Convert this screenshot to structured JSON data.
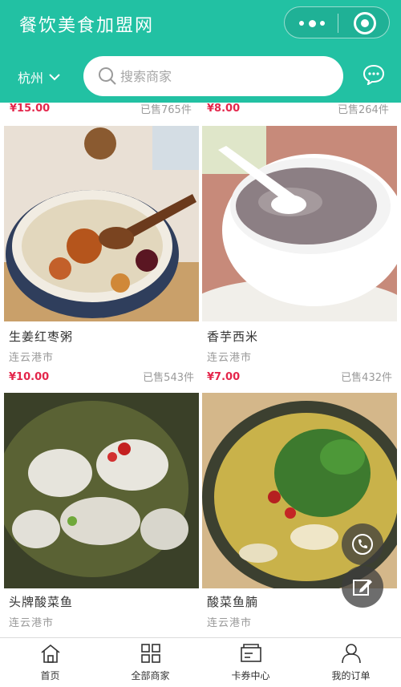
{
  "header": {
    "title": "餐饮美食加盟网",
    "menu_icon": "more-dots-icon",
    "close_icon": "target-icon"
  },
  "search": {
    "city": "杭州",
    "placeholder": "搜索商家",
    "message_icon": "chat-bubble-icon"
  },
  "top_partial_row": [
    {
      "price": "¥15.00",
      "sold": "已售765件"
    },
    {
      "price": "¥8.00",
      "sold": "已售264件"
    }
  ],
  "products": [
    {
      "name": "生姜红枣粥",
      "location": "连云港市",
      "price": "¥10.00",
      "sold": "已售543件",
      "image": "porridge-bowl"
    },
    {
      "name": "香芋西米",
      "location": "连云港市",
      "price": "¥7.00",
      "sold": "已售432件",
      "image": "taro-sago-bowl"
    },
    {
      "name": "头牌酸菜鱼",
      "location": "连云港市",
      "image": "pickled-fish"
    },
    {
      "name": "酸菜鱼腩",
      "location": "连云港市",
      "image": "fish-belly-soup"
    }
  ],
  "tabbar": [
    {
      "label": "首页",
      "icon": "home-icon"
    },
    {
      "label": "全部商家",
      "icon": "grid-icon"
    },
    {
      "label": "卡券中心",
      "icon": "card-icon"
    },
    {
      "label": "我的订单",
      "icon": "user-icon"
    }
  ],
  "colors": {
    "brand": "#22c1a3",
    "price": "#e4264b"
  }
}
